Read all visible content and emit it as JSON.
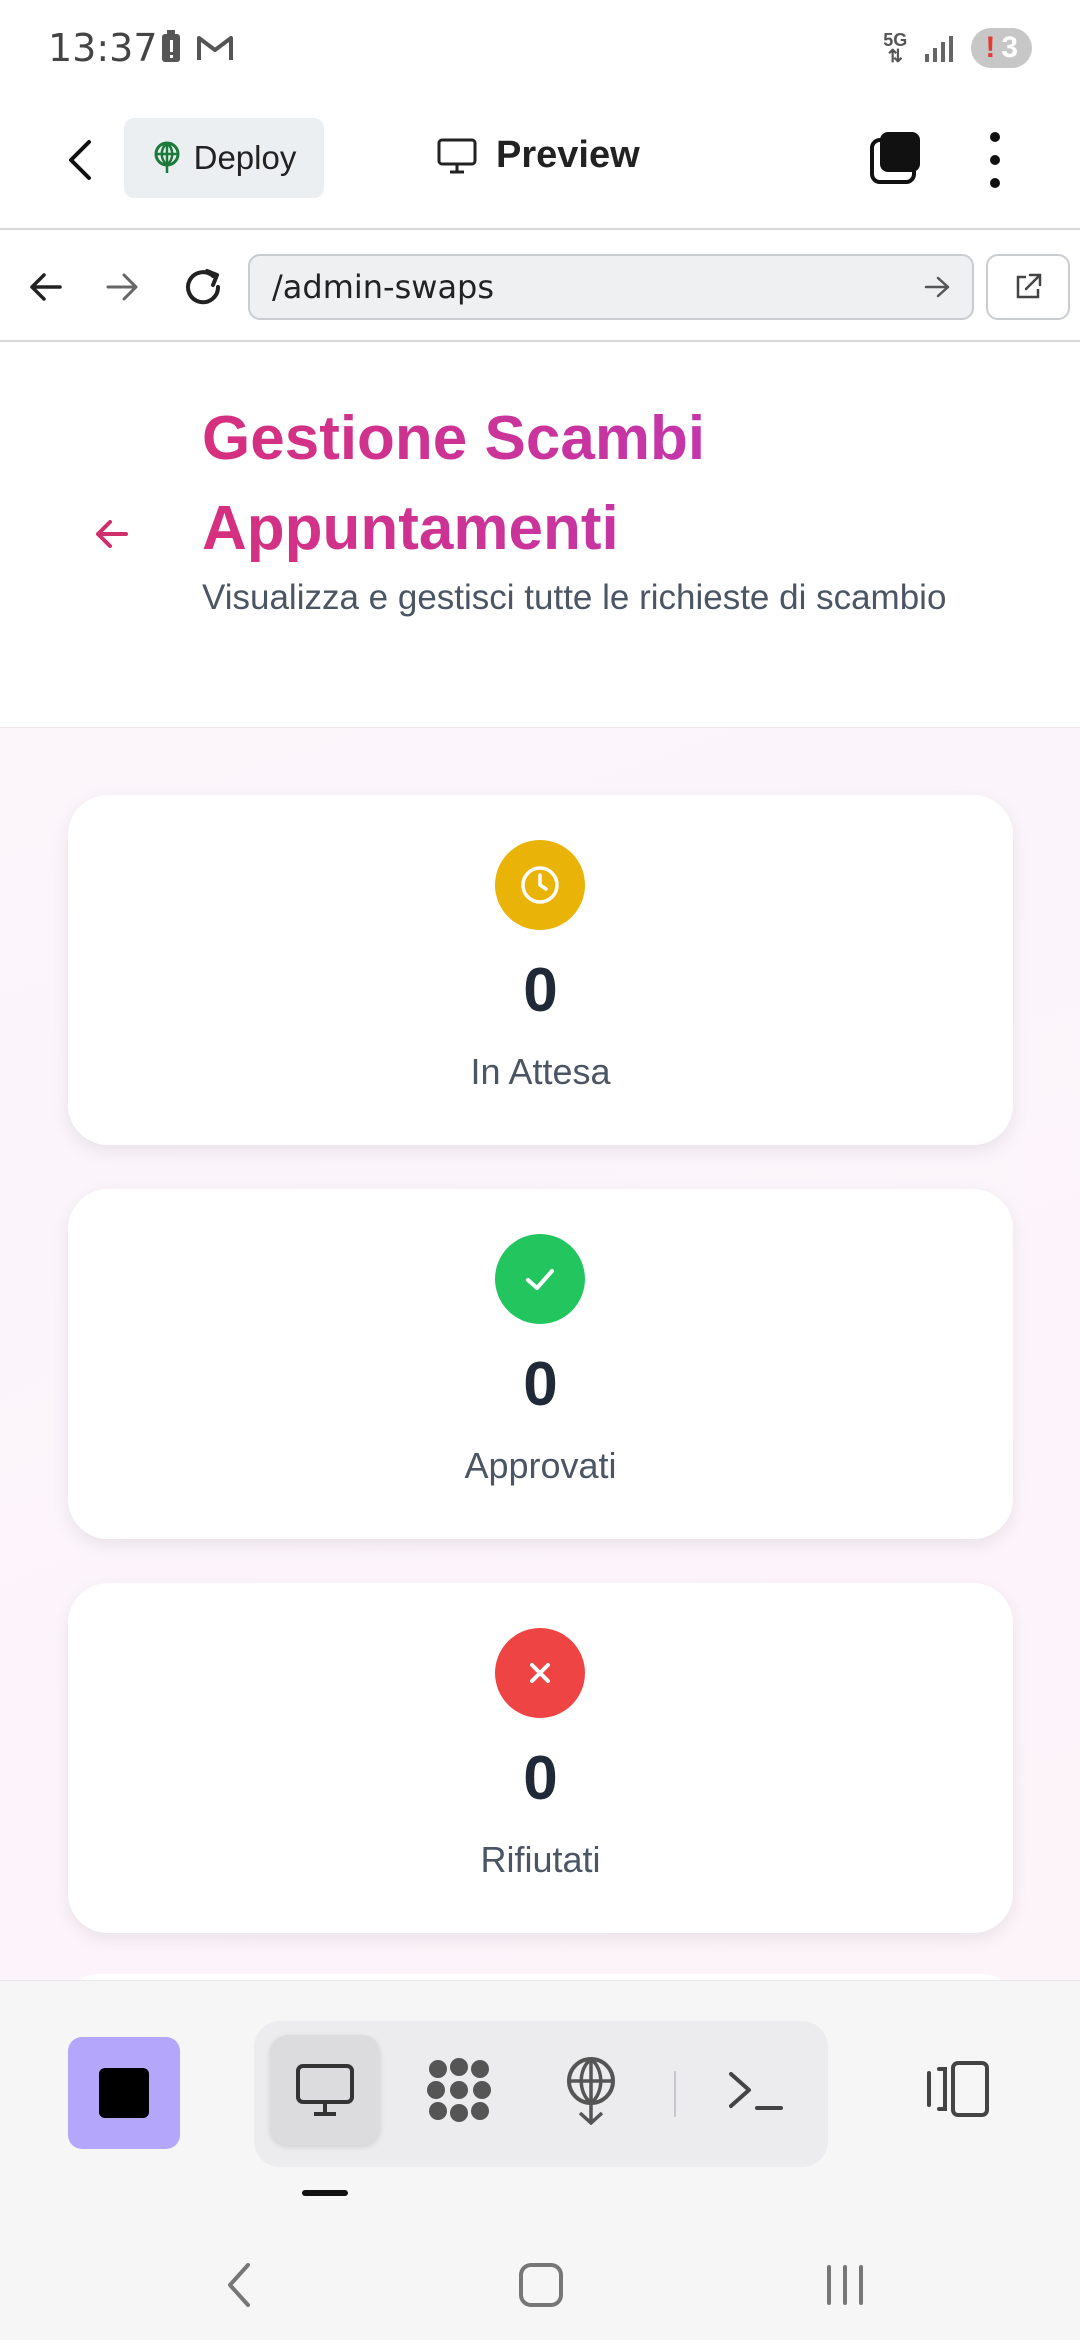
{
  "status_bar": {
    "time": "13:37",
    "network": "5G",
    "notification_count": "3"
  },
  "app_header": {
    "deploy_label": "Deploy",
    "preview_label": "Preview"
  },
  "browser": {
    "url": "/admin-swaps"
  },
  "page": {
    "title": "Gestione Scambi Appuntamenti",
    "subtitle": "Visualizza e gestisci tutte le richieste di scambio"
  },
  "stats": [
    {
      "value": "0",
      "label": "In Attesa",
      "icon": "clock-icon",
      "color": "#eab308"
    },
    {
      "value": "0",
      "label": "Approvati",
      "icon": "check-icon",
      "color": "#22c55e"
    },
    {
      "value": "0",
      "label": "Rifiutati",
      "icon": "x-icon",
      "color": "#ef4444"
    }
  ],
  "colors": {
    "accent_pink": "#d6307e",
    "stop_button": "#b3a6fb"
  }
}
